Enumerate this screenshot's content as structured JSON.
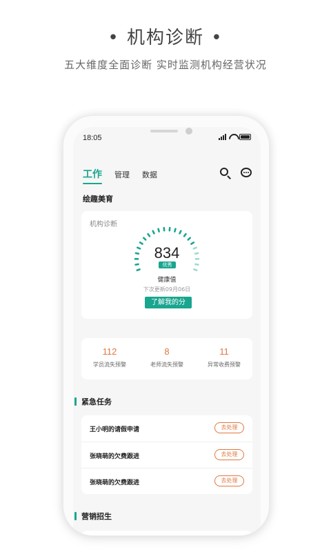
{
  "promo": {
    "title": "• 机构诊断 •",
    "subtitle": "五大维度全面诊断 实时监测机构经营状况"
  },
  "statusbar": {
    "time": "18:05"
  },
  "tabs": [
    {
      "label": "工作",
      "active": true
    },
    {
      "label": "管理",
      "active": false
    },
    {
      "label": "数据",
      "active": false
    }
  ],
  "icons": {
    "search": "search-icon",
    "message": "message-icon"
  },
  "org_name": "绘趣美育",
  "diagnosis": {
    "label": "机构诊断",
    "score": "834",
    "rating": "优秀",
    "health_label": "健康值",
    "next_update": "下次更新09月06日",
    "learn_button": "了解我的分",
    "gauge_level": 0.75
  },
  "stats": [
    {
      "value": "112",
      "label": "学员流失预警"
    },
    {
      "value": "8",
      "label": "老师流失预警"
    },
    {
      "value": "11",
      "label": "异常收费预警"
    }
  ],
  "urgent": {
    "title": "紧急任务",
    "tasks": [
      {
        "title": "王小明的请假申请",
        "action": "去处理"
      },
      {
        "title": "张晓萌的欠费跟进",
        "action": "去处理"
      },
      {
        "title": "张晓萌的欠费跟进",
        "action": "去处理"
      }
    ]
  },
  "marketing": {
    "title": "营销招生"
  },
  "colors": {
    "accent": "#1aa58f",
    "warning": "#e0773e"
  }
}
